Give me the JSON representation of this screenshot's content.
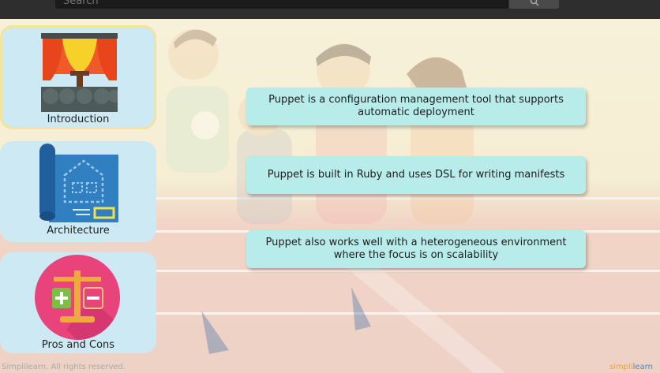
{
  "search": {
    "placeholder": "Search"
  },
  "cards": [
    {
      "label": "Introduction"
    },
    {
      "label": "Architecture"
    },
    {
      "label": "Pros and Cons"
    }
  ],
  "points": [
    "Puppet is a configuration management tool that supports automatic deployment",
    "Puppet is built in Ruby and uses DSL for writing manifests",
    "Puppet also works well with a heterogeneous environment where the focus is on scalability"
  ],
  "footer": {
    "copyright": "Simplilearn. All rights reserved.",
    "logo_a": "simpli",
    "logo_b": "learn"
  },
  "colors": {
    "card_bg": "#cde9f4",
    "info_box_bg": "#b7ecea",
    "active_border": "#f4e39a",
    "brand_blue": "#3a8ad6",
    "brand_orange": "#f0a22f"
  }
}
